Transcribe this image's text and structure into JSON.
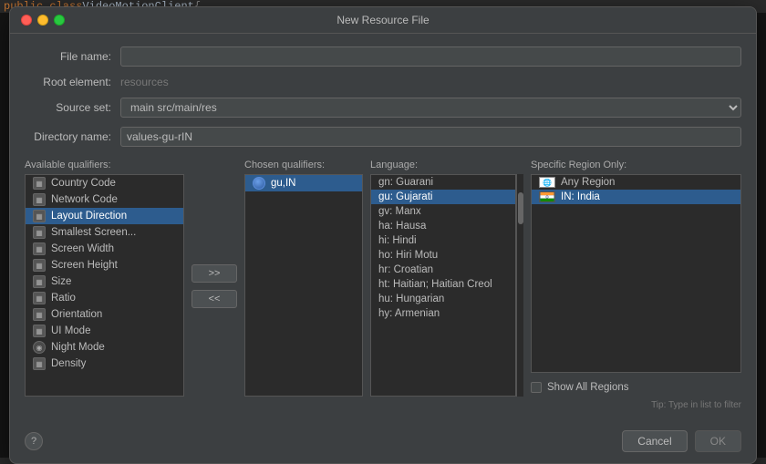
{
  "codeLine": {
    "prefix": "public class ",
    "className": "VideoMotionClient",
    "suffix": " {"
  },
  "dialog": {
    "title": "New Resource File",
    "trafficLights": {
      "close": "close",
      "minimize": "minimize",
      "maximize": "maximize"
    }
  },
  "form": {
    "fileName": {
      "label": "File name:",
      "value": "",
      "placeholder": ""
    },
    "rootElement": {
      "label": "Root element:",
      "value": "resources"
    },
    "sourceSet": {
      "label": "Source set:",
      "value": "main  src/main/res",
      "options": [
        "main  src/main/res"
      ]
    },
    "directoryName": {
      "label": "Directory name:",
      "value": "values-gu-rIN"
    }
  },
  "availableQualifiers": {
    "label": "Available qualifiers:",
    "items": [
      {
        "id": "country-code",
        "label": "Country Code",
        "icon": "grid"
      },
      {
        "id": "network-code",
        "label": "Network Code",
        "icon": "grid"
      },
      {
        "id": "layout-direction",
        "label": "Layout Direction",
        "icon": "grid",
        "selected": true
      },
      {
        "id": "smallest-screen",
        "label": "Smallest Screen...",
        "icon": "grid"
      },
      {
        "id": "screen-width",
        "label": "Screen Width",
        "icon": "grid"
      },
      {
        "id": "screen-height",
        "label": "Screen Height",
        "icon": "grid"
      },
      {
        "id": "size",
        "label": "Size",
        "icon": "grid"
      },
      {
        "id": "ratio",
        "label": "Ratio",
        "icon": "grid"
      },
      {
        "id": "orientation",
        "label": "Orientation",
        "icon": "grid"
      },
      {
        "id": "ui-mode",
        "label": "UI Mode",
        "icon": "grid"
      },
      {
        "id": "night-mode",
        "label": "Night Mode",
        "icon": "circle"
      },
      {
        "id": "density",
        "label": "Density",
        "icon": "grid"
      }
    ]
  },
  "chosenQualifiers": {
    "label": "Chosen qualifiers:",
    "items": [
      {
        "id": "gu-in",
        "label": "gu,IN",
        "selected": true
      }
    ]
  },
  "arrows": {
    "add": ">>",
    "remove": "<<"
  },
  "language": {
    "label": "Language:",
    "items": [
      {
        "id": "gn",
        "label": "gn: Guarani"
      },
      {
        "id": "gu",
        "label": "gu: Gujarati",
        "selected": true
      },
      {
        "id": "gv",
        "label": "gv: Manx"
      },
      {
        "id": "ha",
        "label": "ha: Hausa"
      },
      {
        "id": "hi",
        "label": "hi: Hindi"
      },
      {
        "id": "ho",
        "label": "ho: Hiri Motu"
      },
      {
        "id": "hr",
        "label": "hr: Croatian"
      },
      {
        "id": "ht",
        "label": "ht: Haitian; Haitian Creol"
      },
      {
        "id": "hu",
        "label": "hu: Hungarian"
      },
      {
        "id": "hy",
        "label": "hy: Armenian"
      }
    ]
  },
  "specificRegion": {
    "label": "Specific Region Only:",
    "items": [
      {
        "id": "any",
        "label": "Any Region",
        "flag": "any"
      },
      {
        "id": "in",
        "label": "IN: India",
        "flag": "india",
        "selected": true
      }
    ],
    "showAllRegions": {
      "checked": false,
      "label": "Show All Regions"
    }
  },
  "footer": {
    "help": "?",
    "tip": "Tip: Type in list to filter",
    "cancelLabel": "Cancel",
    "okLabel": "OK"
  }
}
